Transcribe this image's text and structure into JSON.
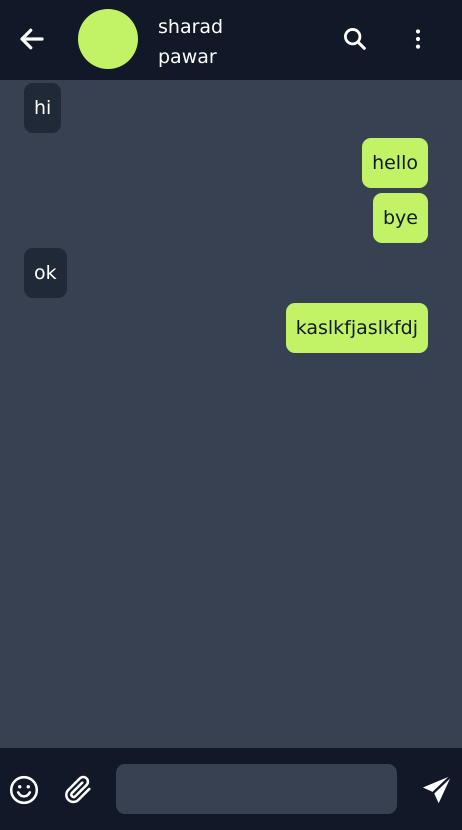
{
  "header": {
    "contact_name": "sharad pawar",
    "avatar_color": "#c2f266",
    "icons": {
      "back": "arrow-left-icon",
      "search": "search-icon",
      "menu": "more-vertical-icon"
    }
  },
  "messages": [
    {
      "text": "hi",
      "direction": "incoming"
    },
    {
      "text": "hello",
      "direction": "outgoing"
    },
    {
      "text": "bye",
      "direction": "outgoing"
    },
    {
      "text": "ok",
      "direction": "incoming"
    },
    {
      "text": "kaslkfjaslkfdj",
      "direction": "outgoing"
    }
  ],
  "composer": {
    "input_value": "",
    "input_placeholder": "",
    "icons": {
      "emoji": "smiley-icon",
      "attach": "paperclip-icon",
      "send": "send-icon"
    }
  },
  "colors": {
    "header_bg": "#111827",
    "chat_bg": "#374151",
    "incoming_bubble": "#1f2937",
    "outgoing_bubble": "#c2f266"
  }
}
